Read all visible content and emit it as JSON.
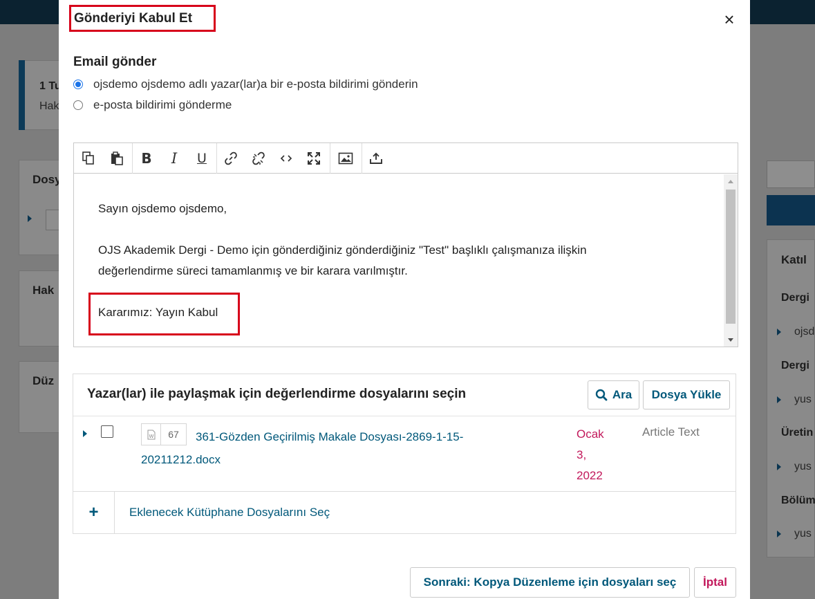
{
  "background": {
    "notice_title": "1 Tu",
    "notice_text": "Hak",
    "card1_title": "Dosy",
    "card2_title": "Hak",
    "card3_title": "Düz",
    "right_card_title": "Katıl",
    "right_sections": [
      {
        "heading": "Dergi",
        "item": "ojsd"
      },
      {
        "heading": "Dergi",
        "item": "yus"
      },
      {
        "heading": "Üretin",
        "item": "yus"
      },
      {
        "heading": "Bölüm",
        "item": "yus"
      }
    ]
  },
  "modal": {
    "title": "Gönderiyi Kabul Et",
    "close_icon": "close-icon",
    "email_section_label": "Email gönder",
    "radio_options": [
      {
        "label": "ojsdemo ojsdemo adlı yazar(lar)a bir e-posta bildirimi gönderin",
        "checked": true
      },
      {
        "label": "e-posta bildirimi gönderme",
        "checked": false
      }
    ],
    "editor": {
      "toolbar_icons": [
        "copy-icon",
        "paste-icon",
        "bold-icon",
        "italic-icon",
        "underline-icon",
        "link-icon",
        "unlink-icon",
        "code-icon",
        "fullscreen-icon",
        "image-icon",
        "upload-icon"
      ],
      "greeting": "Sayın ojsdemo ojsdemo,",
      "body_line1": "OJS Akademik Dergi - Demo için gönderdiğiniz gönderdiğiniz \"Test\" başlıklı çalışmanıza ilişkin",
      "body_line2": "değerlendirme süreci tamamlanmış ve bir karara varılmıştır.",
      "decision": "Kararımız: Yayın Kabul"
    },
    "files": {
      "title": "Yazar(lar) ile paylaşmak için değerlendirme dosyalarını seçin",
      "search_label": "Ara",
      "upload_label": "Dosya Yükle",
      "rows": [
        {
          "id": "67",
          "name": "361-Gözden Geçirilmiş Makale Dosyası-2869-1-15-20211212.docx",
          "date_line1": "Ocak",
          "date_line2": "3,",
          "date_line3": "2022",
          "type": "Article Text"
        }
      ]
    },
    "library_label": "Eklenecek Kütüphane Dosyalarını Seç",
    "next_button": "Sonraki: Kopya Düzenleme için dosyaları seç",
    "cancel_button": "İptal",
    "colors": {
      "link": "#00587a",
      "date": "#c2185b",
      "highlight": "#d7001a",
      "radio": "#1a73e8"
    }
  }
}
